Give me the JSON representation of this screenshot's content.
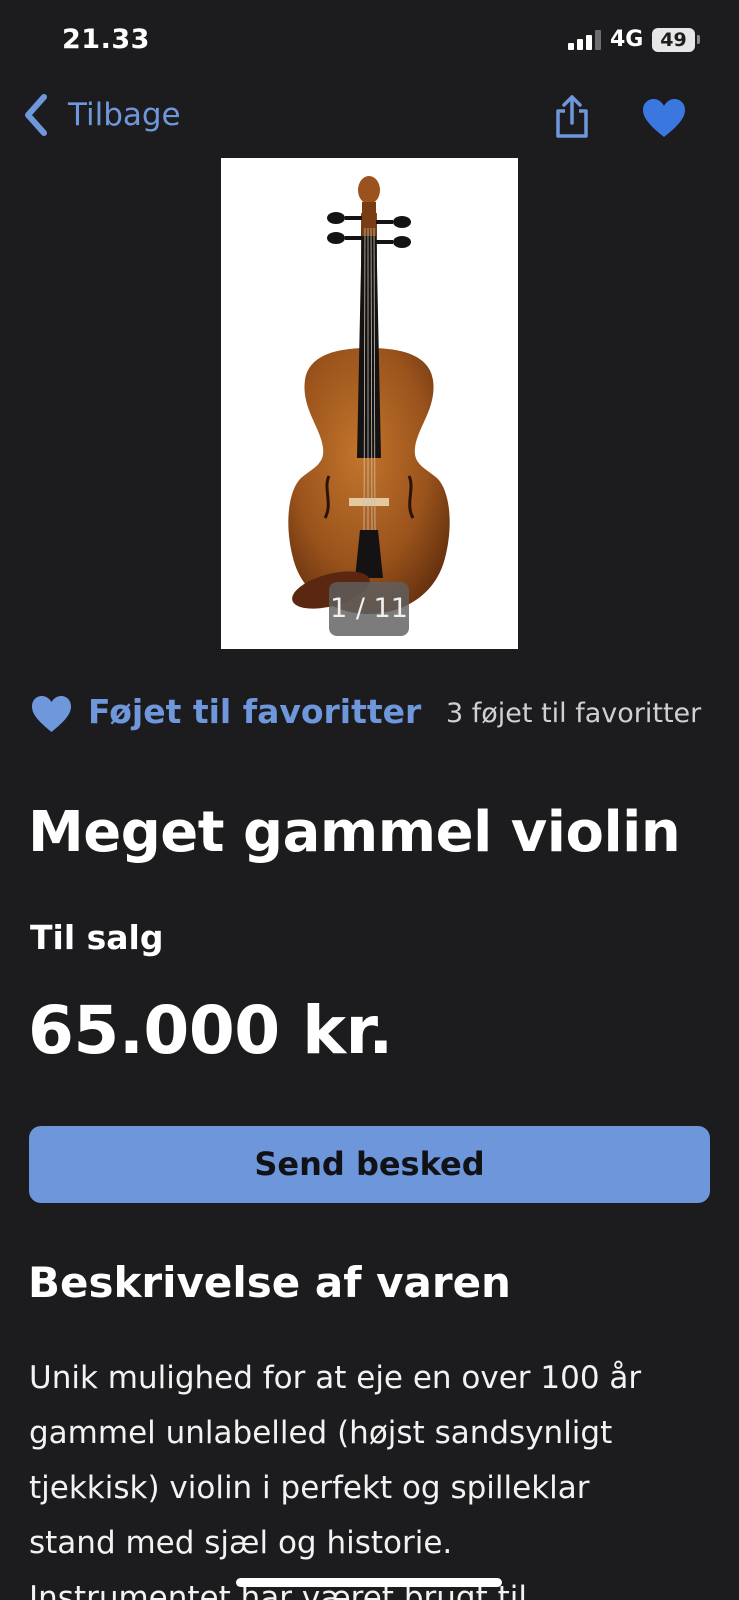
{
  "status_bar": {
    "time": "21.33",
    "network": "4G",
    "battery": "49"
  },
  "nav": {
    "back_label": "Tilbage"
  },
  "gallery": {
    "counter": "1 / 11"
  },
  "favorites": {
    "label": "Føjet til favoritter",
    "count_text": "3 føjet til favoritter"
  },
  "listing": {
    "title": "Meget gammel violin",
    "status": "Til salg",
    "price": "65.000 kr."
  },
  "actions": {
    "send_message": "Send besked"
  },
  "description": {
    "heading": "Beskrivelse af varen",
    "lines": [
      "Unik mulighed for at eje en over 100 år",
      "gammel unlabelled (højst sandsynligt",
      "tjekkisk) violin i perfekt og spilleklar",
      "stand med sjæl og historie.",
      "Instrumentet har været brugt til"
    ]
  },
  "colors": {
    "accent": "#6f97db",
    "button": "#6e96da",
    "background": "#1c1c1e"
  }
}
